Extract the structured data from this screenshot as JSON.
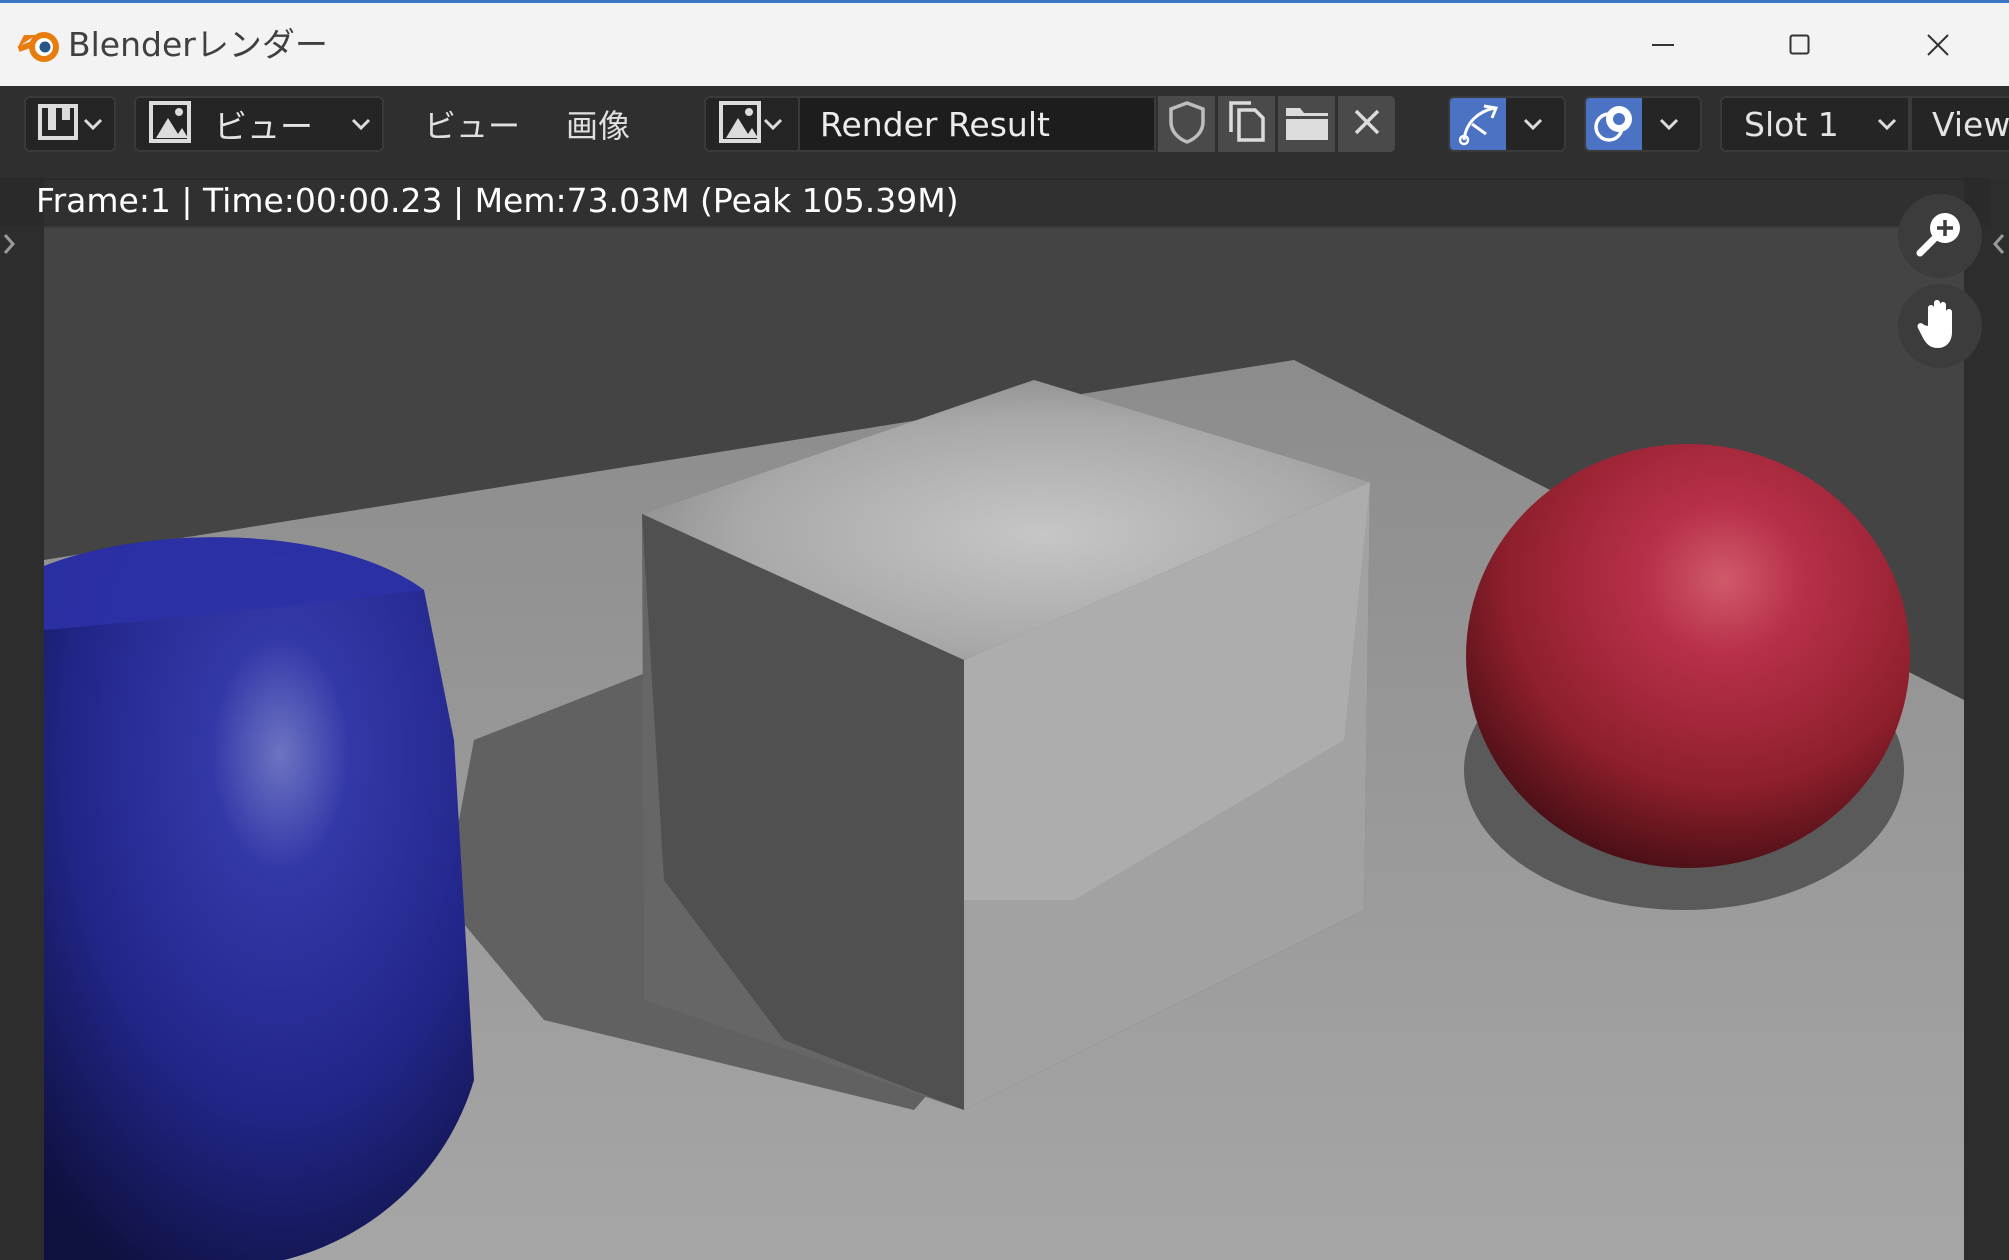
{
  "window": {
    "title": "Blenderレンダー",
    "controls": [
      "minimize-icon",
      "maximize-icon",
      "close-icon"
    ]
  },
  "header": {
    "editor_type_icon": "image-editor-icon",
    "view_mode": {
      "icon": "image-icon",
      "label": "ビュー"
    },
    "menus": [
      "ビュー",
      "画像"
    ],
    "image_browse_icon": "image-browse-icon",
    "image_name": "Render Result",
    "image_buttons": [
      "fake-user-shield-icon",
      "duplicate-icon",
      "open-folder-icon",
      "unlink-close-icon"
    ],
    "gizmo_toggle_icon": "gizmo-arrow-icon",
    "overlay_toggle_icon": "overlay-icon",
    "slot": "Slot 1",
    "view_layer": "View"
  },
  "viewport": {
    "stats": "Frame:1 | Time:00:00.23 | Mem:73.03M (Peak 105.39M)",
    "nav_gizmos": [
      "zoom-in-icon",
      "pan-hand-icon"
    ],
    "sidebar_toggles": [
      "left-panel-arrow-icon",
      "right-panel-arrow-icon"
    ]
  },
  "colors": {
    "accent_blue": "#4c72c4",
    "header_bg": "#2f2f2f",
    "titlebar_bg": "#f3f3f3",
    "render_bg": "#3f3f3f",
    "cylinder": "#25279b",
    "sphere": "#b02a3e",
    "cube": "#9a9a9a"
  }
}
